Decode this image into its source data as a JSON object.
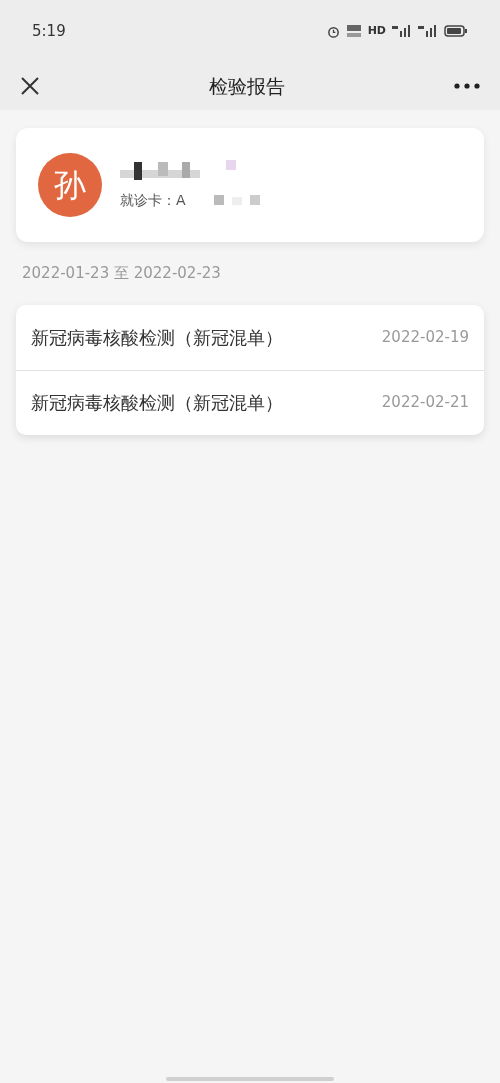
{
  "status_bar": {
    "time": "5:19",
    "hd": "HD"
  },
  "header": {
    "title": "检验报告"
  },
  "patient": {
    "avatar": "孙",
    "card_label": "就诊卡：A"
  },
  "date_range": "2022-01-23 至 2022-02-23",
  "reports": [
    {
      "name": "新冠病毒核酸检测（新冠混单）",
      "date": "2022-02-19"
    },
    {
      "name": "新冠病毒核酸检测（新冠混单）",
      "date": "2022-02-21"
    }
  ]
}
